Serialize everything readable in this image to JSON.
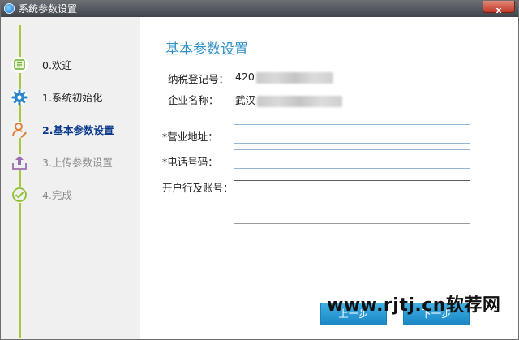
{
  "window": {
    "title": "系统参数设置",
    "close_label": "x"
  },
  "sidebar": {
    "steps": [
      {
        "label": "0.欢迎",
        "state": "done"
      },
      {
        "label": "1.系统初始化",
        "state": "done"
      },
      {
        "label": "2.基本参数设置",
        "state": "active"
      },
      {
        "label": "3.上传参数设置",
        "state": "disabled"
      },
      {
        "label": "4.完成",
        "state": "disabled"
      }
    ]
  },
  "main": {
    "heading": "基本参数设置",
    "tax_id": {
      "label": "纳税登记号：",
      "value_prefix": "420"
    },
    "company": {
      "label": "企业名称：",
      "value_prefix": "武汉"
    },
    "address": {
      "label": "*营业地址：",
      "value": ""
    },
    "phone": {
      "label": "*电话号码：",
      "value": ""
    },
    "bank": {
      "label": "开户行及账号：",
      "value": ""
    }
  },
  "buttons": {
    "prev": "上一步",
    "next": "下一步"
  },
  "watermark": "www.rjtj.cn软荐网",
  "colors": {
    "accent": "#2f8fc6",
    "track": "#a6c83a",
    "button": "#1a86c4"
  }
}
